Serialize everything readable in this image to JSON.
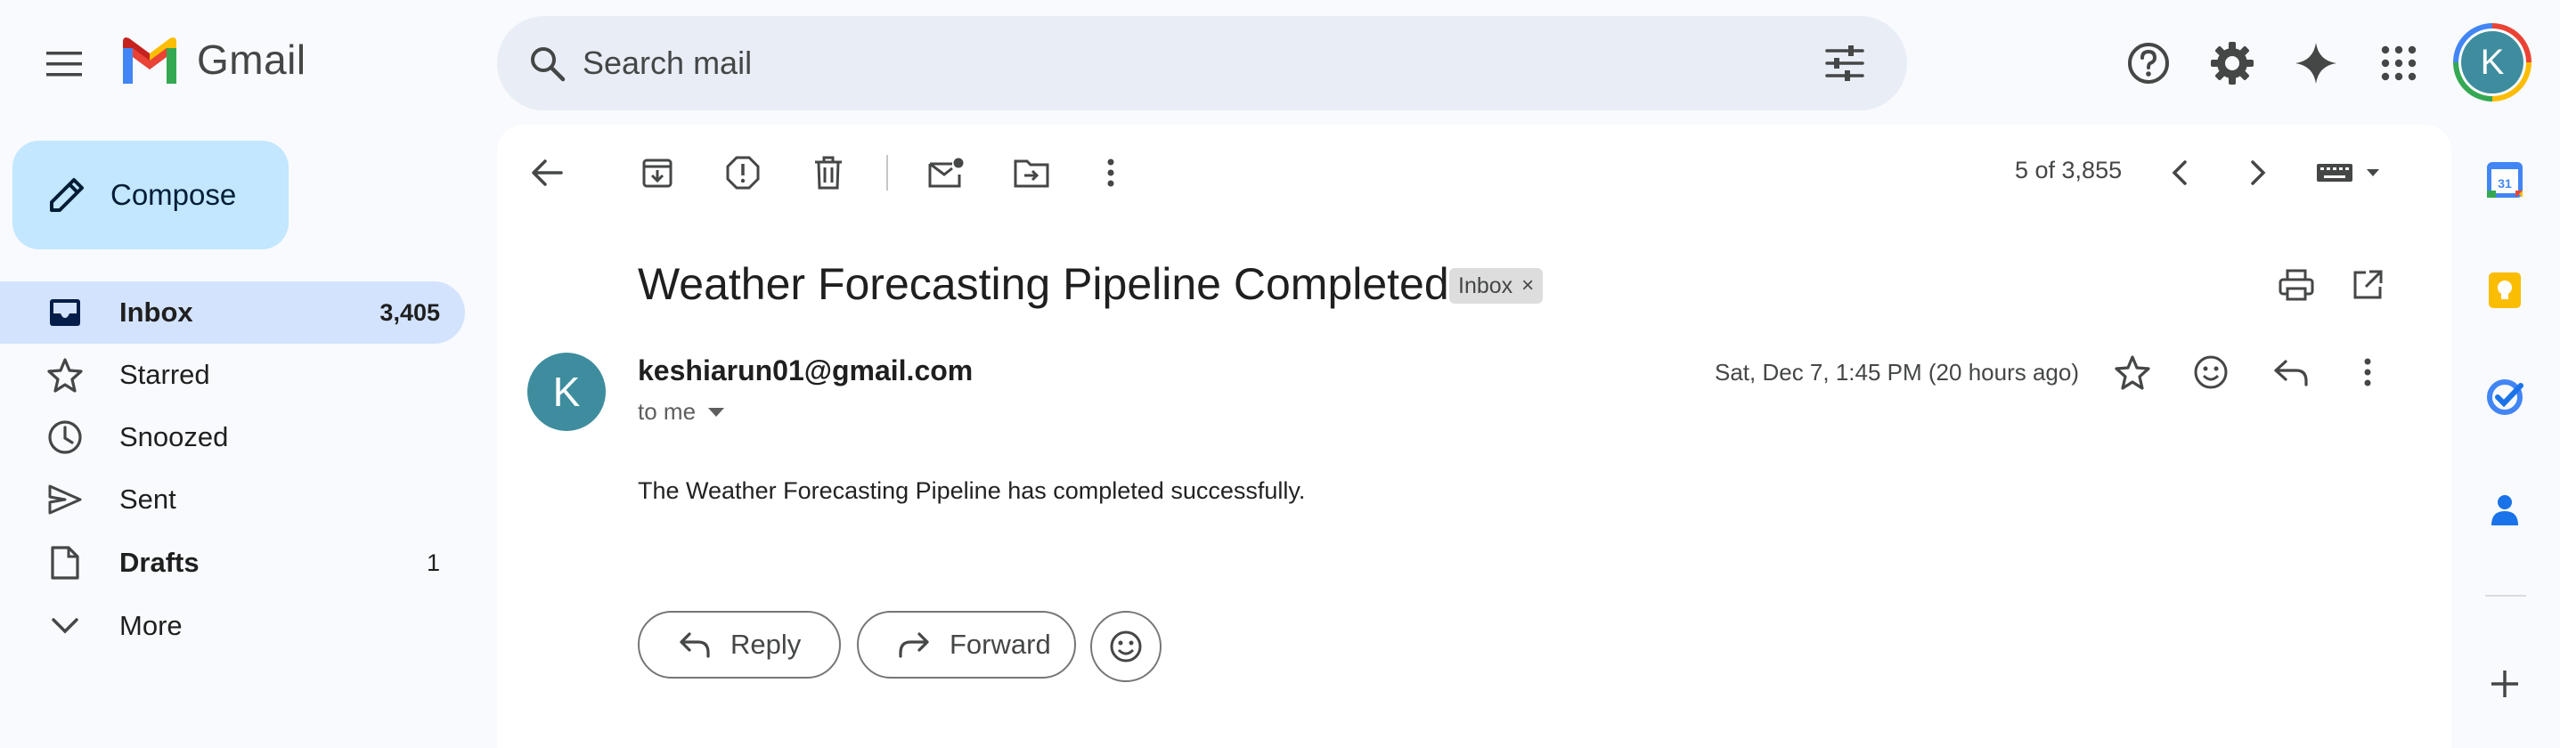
{
  "app": {
    "name": "Gmail"
  },
  "search": {
    "placeholder": "Search mail"
  },
  "sidebar": {
    "compose_label": "Compose",
    "items": [
      {
        "label": "Inbox",
        "count": "3,405",
        "icon": "inbox-icon",
        "active": true,
        "bold": true
      },
      {
        "label": "Starred",
        "count": "",
        "icon": "star-icon"
      },
      {
        "label": "Snoozed",
        "count": "",
        "icon": "clock-icon"
      },
      {
        "label": "Sent",
        "count": "",
        "icon": "send-icon"
      },
      {
        "label": "Drafts",
        "count": "1",
        "icon": "draft-icon",
        "bold": true
      },
      {
        "label": "More",
        "count": "",
        "icon": "chevron-down-icon"
      }
    ]
  },
  "toolbar": {
    "pager": "5 of 3,855"
  },
  "message": {
    "subject": "Weather Forecasting Pipeline Completed",
    "label_chip": "Inbox",
    "label_chip_close": "×",
    "sender_initial": "K",
    "sender_email": "keshiarun01@gmail.com",
    "to_line": "to me",
    "date": "Sat, Dec 7, 1:45 PM (20 hours ago)",
    "body": "The Weather Forecasting Pipeline has completed successfully."
  },
  "actions": {
    "reply_label": "Reply",
    "forward_label": "Forward"
  },
  "account": {
    "initial": "K"
  },
  "colors": {
    "accent": "#0b57d0",
    "compose_bg": "#c2e7ff",
    "active_nav_bg": "#d3e3fd",
    "search_bg": "#e9eef6",
    "avatar_bg": "#3e8d9e"
  },
  "right_rail": [
    "calendar-icon",
    "keep-icon",
    "tasks-icon",
    "contacts-icon",
    "add-icon"
  ]
}
